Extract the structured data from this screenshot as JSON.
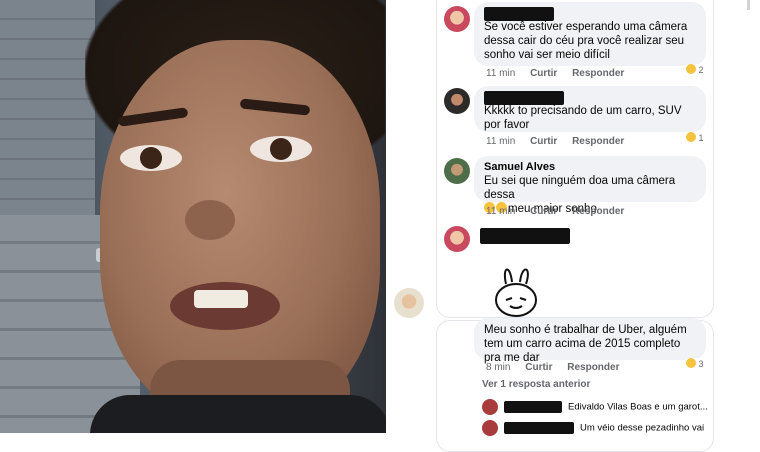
{
  "comments": [
    {
      "author": "",
      "text": "Se você estiver esperando uma câmera dessa cair do céu pra você realizar seu sonho vai ser meio difícil",
      "time": "11 min",
      "like": "Curtir",
      "reply": "Responder",
      "reactions": "2"
    },
    {
      "author": "",
      "text": "Kkkkk to precisando de um carro, SUV por favor",
      "time": "11 min",
      "like": "Curtir",
      "reply": "Responder",
      "reactions": "1"
    },
    {
      "author": "Samuel Alves",
      "text_line1": "Eu sei que ninguém doa uma câmera dessa",
      "text_line2": "meu maior sonho",
      "time": "11 min",
      "like": "Curtir",
      "reply": "Responder"
    },
    {
      "author": ""
    },
    {
      "text": "Meu sonho é trabalhar de Uber, alguém tem um carro acima de 2015 completo pra me dar",
      "time": "8 min",
      "like": "Curtir",
      "reply": "Responder",
      "reactions": "3"
    }
  ],
  "replies": {
    "view_previous": "Ver 1 resposta anterior",
    "items": [
      {
        "text": "Edivaldo Vilas Boas e um garot..."
      },
      {
        "text": "Um véio desse pezadinho vai"
      }
    ]
  },
  "colors": {
    "bubble": "#f0f2f5",
    "meta": "#65676b",
    "text": "#050505"
  },
  "icons": [
    "haha-reaction-icon",
    "sad-emoji-icon",
    "sticker-rabbit-icon"
  ]
}
